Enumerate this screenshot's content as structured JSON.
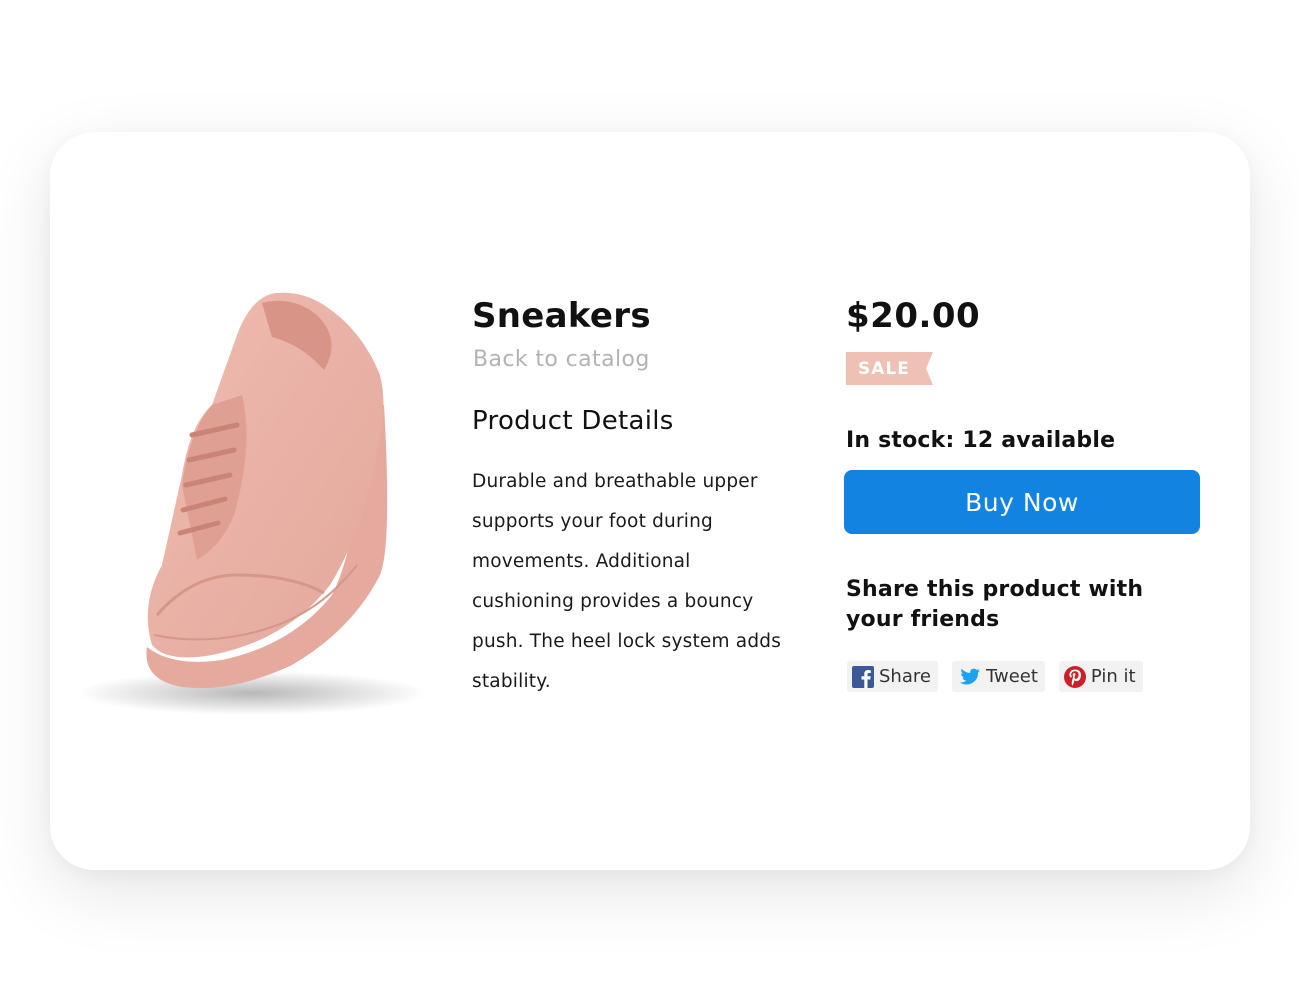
{
  "product": {
    "title": "Sneakers",
    "back_link": "Back to catalog",
    "details_heading": "Product Details",
    "description": "Durable and breathable upper supports your foot during movements. Additional cushioning provides a bouncy push. The heel lock system adds stability.",
    "image_icon": "pink-sneaker-image",
    "color": "#eab1a6"
  },
  "purchase": {
    "price": "$20.00",
    "badge": "SALE",
    "badge_color": "#efc1b5",
    "stock": "In stock: 12 available",
    "buy_label": "Buy Now",
    "buy_color": "#1283e0"
  },
  "share": {
    "heading": "Share this product with your friends",
    "buttons": [
      {
        "label": "Share",
        "icon": "facebook-icon",
        "color": "#3b5998"
      },
      {
        "label": "Tweet",
        "icon": "twitter-icon",
        "color": "#1da1f2"
      },
      {
        "label": "Pin it",
        "icon": "pinterest-icon",
        "color": "#cb2027"
      }
    ]
  }
}
